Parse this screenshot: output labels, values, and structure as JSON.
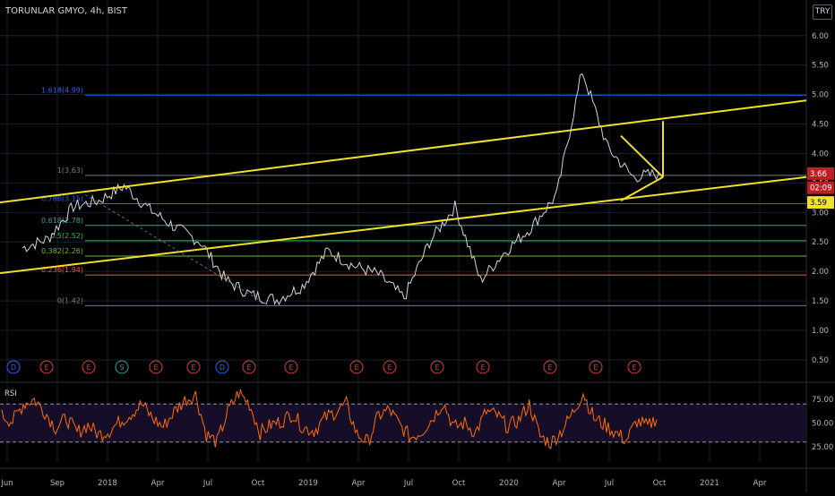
{
  "symbol": "TORUNLAR GMYO, 4h, BIST",
  "currency": "TRY",
  "colors": {
    "background": "#000000",
    "grid": "#1b1f2b",
    "price_line": "#d1d4dc",
    "trend_line": "#f0e12a",
    "rsi_line": "#ff6d00",
    "rsi_band": "#160d29",
    "current_price_bg": "#c11e21"
  },
  "chart_data": [
    {
      "type": "line",
      "title": "TORUNLAR GMYO, 4h, BIST",
      "x_tick_labels": [
        "Jun",
        "Sep",
        "2018",
        "Apr",
        "Jul",
        "Oct",
        "2019",
        "Apr",
        "Jul",
        "Oct",
        "2020",
        "Apr",
        "Jul",
        "Oct",
        "2021",
        "Apr"
      ],
      "y_tick_labels": [
        "6.00",
        "5.50",
        "5.00",
        "4.50",
        "4.00",
        "3.50",
        "3.00",
        "2.50",
        "2.00",
        "1.50",
        "1.00",
        "0.50"
      ],
      "ylim": [
        0.15,
        6.3
      ],
      "grid": true,
      "x": [
        "2017-05",
        "2017-07",
        "2017-09",
        "2017-11",
        "2018-01",
        "2018-03",
        "2018-05",
        "2018-07",
        "2018-09",
        "2018-11",
        "2019-01",
        "2019-03",
        "2019-05",
        "2019-07",
        "2019-09",
        "2019-11",
        "2020-01",
        "2020-02",
        "2020-03",
        "2020-04",
        "2020-05",
        "2020-06",
        "2020-07",
        "2020-08",
        "2020-09",
        "2020-10"
      ],
      "series": [
        {
          "values": [
            2.4,
            2.55,
            3.1,
            3.2,
            3.45,
            3.05,
            2.75,
            2.5,
            1.85,
            1.6,
            1.52,
            1.75,
            2.35,
            2.1,
            1.95,
            1.55,
            2.5,
            3.1,
            1.85,
            2.35,
            2.75,
            3.3,
            5.4,
            4.1,
            3.6,
            3.66
          ]
        }
      ],
      "fibonacci_levels": [
        {
          "label": "1.618(4.99)",
          "value": 4.99,
          "color": "#2962ff"
        },
        {
          "label": "1(3.63)",
          "value": 3.63,
          "color": "#787b86"
        },
        {
          "label": "0.786(3.15)",
          "value": 3.15,
          "color": "#2962ff"
        },
        {
          "label": "0.618(2.78)",
          "value": 2.78,
          "color": "#26a69a"
        },
        {
          "label": "0.5(2.52)",
          "value": 2.52,
          "color": "#4caf50"
        },
        {
          "label": "0.382(2.26)",
          "value": 2.26,
          "color": "#7cb342"
        },
        {
          "label": "0.236(1.94)",
          "value": 1.94,
          "color": "#ef5350"
        },
        {
          "label": "0(1.42)",
          "value": 1.42,
          "color": "#787b86"
        }
      ],
      "price_labels": [
        {
          "text": "3.66",
          "value": 3.66,
          "bg": "#c11e21",
          "fg": "#ffffff"
        },
        {
          "text": "02:09",
          "value": 3.42,
          "bg": "#c11e21",
          "fg": "#ffffff"
        },
        {
          "text": "3.59",
          "value": 3.17,
          "bg": "#f0e12a",
          "fg": "#000000"
        }
      ],
      "event_markers": [
        "D",
        "E",
        "E",
        "S",
        "E",
        "E",
        "D",
        "E",
        "E",
        "E",
        "E",
        "E",
        "E",
        "E",
        "E",
        "E",
        "E"
      ]
    },
    {
      "type": "line",
      "title": "RSI",
      "y_tick_labels": [
        "75.00",
        "50.00",
        "25.00"
      ],
      "ylim": [
        10,
        90
      ],
      "bands": [
        70,
        30
      ],
      "series": [
        {
          "values": [
            58,
            52,
            70,
            75,
            62,
            45,
            55,
            40,
            48,
            38,
            42,
            52,
            60,
            70,
            55,
            46,
            62,
            74,
            80,
            38,
            30,
            62,
            82,
            70,
            40,
            48,
            52,
            60,
            45,
            42,
            55,
            62,
            70,
            38,
            30,
            58,
            64,
            47,
            35,
            41,
            55,
            72,
            45,
            50,
            40,
            62,
            58,
            46,
            53,
            70,
            36,
            29,
            42,
            60,
            82,
            55,
            48,
            40,
            32,
            52,
            46,
            58
          ]
        }
      ]
    }
  ]
}
